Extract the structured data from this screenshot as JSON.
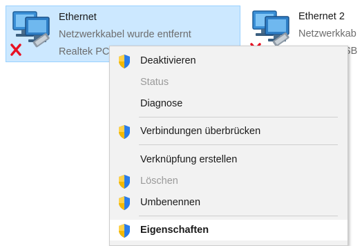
{
  "adapters": [
    {
      "name": "Ethernet",
      "status": "Netzwerkkabel wurde entfernt",
      "device": "Realtek PC",
      "selected": true,
      "icon": "network-adapter-disconnected-icon"
    },
    {
      "name": "Ethernet 2",
      "status": "Netzwerkkab",
      "device": "SB",
      "selected": false,
      "icon": "network-adapter-disconnected-icon"
    }
  ],
  "context_menu": {
    "items": [
      {
        "label": "Deaktivieren",
        "shield": true,
        "disabled": false
      },
      {
        "label": "Status",
        "shield": false,
        "disabled": true
      },
      {
        "label": "Diagnose",
        "shield": false,
        "disabled": false
      },
      {
        "label": "Verbindungen überbrücken",
        "shield": true,
        "disabled": false
      },
      {
        "label": "Verknüpfung erstellen",
        "shield": false,
        "disabled": false
      },
      {
        "label": "Löschen",
        "shield": true,
        "disabled": true
      },
      {
        "label": "Umbenennen",
        "shield": true,
        "disabled": false
      },
      {
        "label": "Eigenschaften",
        "shield": true,
        "disabled": false,
        "default": true,
        "highlighted": true
      }
    ]
  },
  "colors": {
    "selection_bg": "#cce8ff",
    "selection_border": "#99d1ff",
    "menu_bg": "#f2f2f2",
    "disabled_text": "#9a9a9a",
    "error_x": "#e81123"
  }
}
